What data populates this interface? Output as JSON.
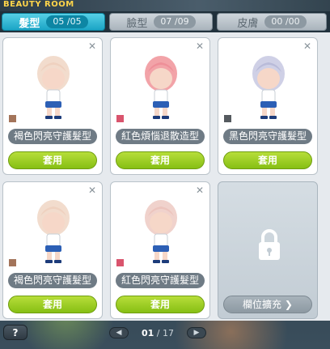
{
  "window": {
    "title": "BEAUTY ROOM"
  },
  "tabs": [
    {
      "label": "髮型",
      "count": "05 /05",
      "active": true
    },
    {
      "label": "臉型",
      "count": "07 /09",
      "active": false
    },
    {
      "label": "皮膚",
      "count": "00 /00",
      "active": false
    }
  ],
  "cards": [
    {
      "name": "褐色閃亮守護髮型",
      "apply_label": "套用",
      "color": "#a3745a",
      "hair": "#f2dccd"
    },
    {
      "name": "紅色煩惱退散造型",
      "apply_label": "套用",
      "color": "#d9546d",
      "hair": "#f2a3a8"
    },
    {
      "name": "黑色閃亮守護髮型",
      "apply_label": "套用",
      "color": "#555a5f",
      "hair": "#cfd0e6"
    },
    {
      "name": "褐色閃亮守護髮型",
      "apply_label": "套用",
      "color": "#a3745a",
      "hair": "#f2dccd"
    },
    {
      "name": "紅色閃亮守護髮型",
      "apply_label": "套用",
      "color": "#d9546d",
      "hair": "#f0d2cc"
    }
  ],
  "locked_slot": {
    "expand_label": "欄位擴充",
    "arrow": "❯"
  },
  "footer": {
    "help_label": "?",
    "page_current": "01",
    "page_sep": " / ",
    "page_total": "17",
    "prev_icon": "◀",
    "next_icon": "▶"
  }
}
